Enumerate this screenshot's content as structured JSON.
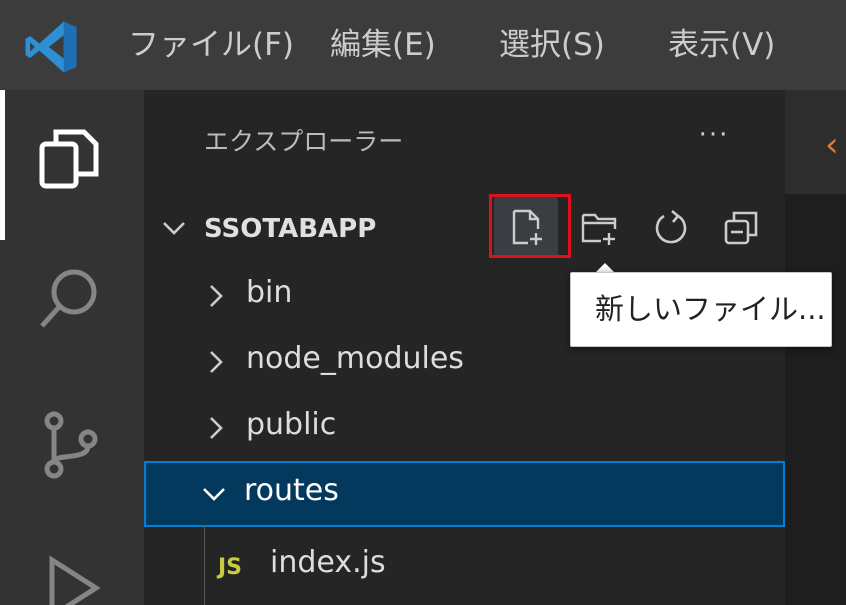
{
  "menu": {
    "items": [
      {
        "label": "ファイル(F)"
      },
      {
        "label": "編集(E)"
      },
      {
        "label": "選択(S)"
      },
      {
        "label": "表示(V)"
      }
    ]
  },
  "activity_bar": {
    "icons": [
      "files-icon",
      "search-icon",
      "source-control-icon",
      "run-debug-icon"
    ]
  },
  "explorer": {
    "title": "エクスプローラー",
    "more": "···",
    "section": {
      "title": "SSOTABAPP",
      "actions": [
        "new-file-icon",
        "new-folder-icon",
        "refresh-icon",
        "collapse-all-icon"
      ]
    },
    "tree": [
      {
        "label": "bin",
        "kind": "folder",
        "expanded": false
      },
      {
        "label": "node_modules",
        "kind": "folder",
        "expanded": false
      },
      {
        "label": "public",
        "kind": "folder",
        "expanded": false
      },
      {
        "label": "routes",
        "kind": "folder",
        "expanded": true
      },
      {
        "label": "index.js",
        "kind": "file",
        "badge": "JS"
      }
    ]
  },
  "tooltip": {
    "text": "新しいファイル..."
  },
  "colors": {
    "accent": "#007fd4",
    "selection_bg": "#04395e",
    "highlight_frame": "#e0101c",
    "js_badge": "#cbcb41"
  }
}
